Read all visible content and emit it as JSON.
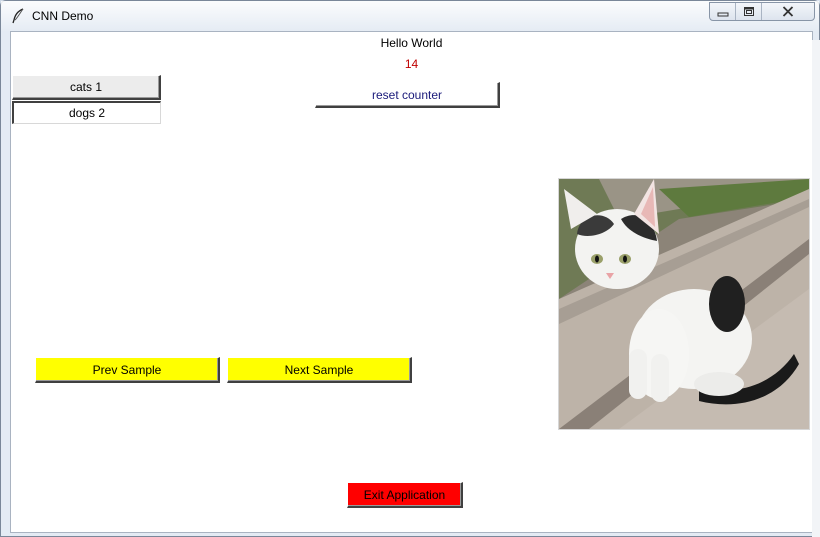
{
  "window": {
    "title": "CNN Demo",
    "icon": "feather-icon",
    "controls": [
      "minimize-icon",
      "maximize-icon",
      "close-icon"
    ]
  },
  "main": {
    "greeting": "Hello World",
    "counter": "14",
    "reset_label": "reset counter"
  },
  "categories": [
    {
      "label": "cats 1",
      "state": "raised"
    },
    {
      "label": "dogs 2",
      "state": "sunken"
    }
  ],
  "navigation": {
    "prev_label": "Prev Sample",
    "next_label": "Next Sample"
  },
  "exit_label": "Exit Application",
  "sample_image": "kitten-photo",
  "colors": {
    "counter": "#c00000",
    "nav_buttons": "#ffff00",
    "exit_button": "#ff0000"
  }
}
